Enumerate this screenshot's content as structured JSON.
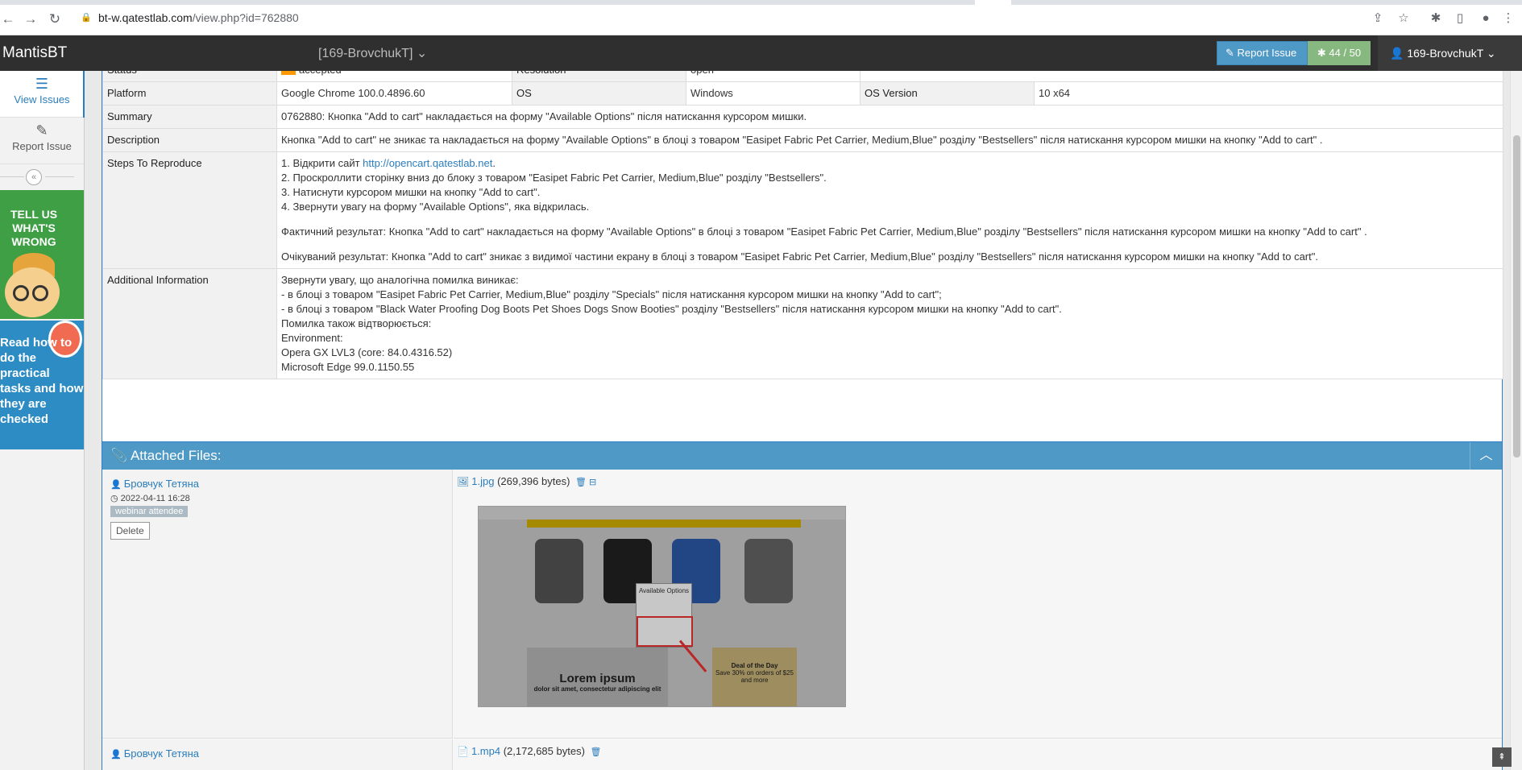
{
  "browser": {
    "url_host": "bt-w.qatestlab.com",
    "url_path": "/view.php?id=762880"
  },
  "navbar": {
    "brand": "MantisBT",
    "project": "[169-BrovchukT]",
    "report_issue": "Report Issue",
    "counter": "44 / 50",
    "user": "169-BrovchukT"
  },
  "sidebar": {
    "view_issues": "View Issues",
    "report_issue": "Report Issue",
    "ad1_text": "TELL US WHAT'S WRONG",
    "ad2_text": "Read how to do the practical tasks and how they are checked"
  },
  "issue": {
    "rows": [
      {
        "label": "Status",
        "value": "accepted",
        "label2": "Resolution",
        "value2": "open"
      },
      {
        "label": "Platform",
        "value": "Google Chrome 100.0.4896.60",
        "label2": "OS",
        "value2": "Windows",
        "label3": "OS Version",
        "value3": "10 x64"
      },
      {
        "label": "Summary",
        "value": "0762880: Кнопка \"Add to cart\" накладається на форму \"Available Options\" після натискання курсором мишки."
      },
      {
        "label": "Description",
        "value": "Кнопка \"Add to cart\" не зникає та накладається на форму \"Available Options\" в блоці з товаром \"Easipet Fabric Pet Carrier, Medium,Blue\" розділу \"Bestsellers\" після натискання курсором мишки на кнопку \"Add to cart\" ."
      },
      {
        "label": "Steps To Reproduce"
      },
      {
        "label": "Additional Information"
      }
    ],
    "steps": {
      "s1_prefix": "1. Відкрити сайт ",
      "s1_link": "http://opencart.qatestlab.net",
      "s1_suffix": ".",
      "s2": "2. Проскроллити сторінку вниз до блоку з товаром \"Easipet Fabric Pet Carrier, Medium,Blue\" розділу \"Bestsellers\".",
      "s3": "3. Натиснути курсором мишки на кнопку \"Add to cart\".",
      "s4": "4. Звернути увагу на форму \"Available Options\", яка відкрилась.",
      "actual": "Фактичний результат: Кнопка \"Add to cart\" накладається на форму \"Available Options\" в блоці з товаром \"Easipet Fabric Pet Carrier, Medium,Blue\" розділу \"Bestsellers\" після натискання курсором мишки на кнопку \"Add to cart\" .",
      "expected": "Очікуваний результат: Кнопка \"Add to cart\" зникає з видимої частини екрану в блоці з товаром \"Easipet Fabric Pet Carrier, Medium,Blue\" розділу \"Bestsellers\" після натискання курсором мишки на кнопку \"Add to cart\"."
    },
    "additional": [
      "Звернути увагу, що аналогічна помилка виникає:",
      "- в блоці з товаром \"Easipet Fabric Pet Carrier, Medium,Blue\" розділу \"Specials\" після натискання курсором мишки на кнопку \"Add to cart\";",
      "- в блоці з товаром \"Black Water Proofing Dog Boots Pet Shoes Dogs Snow Booties\" розділу \"Bestsellers\" після натискання курсором мишки на кнопку \"Add to cart\".",
      "Помилка також відтворюється:",
      "Environment:",
      "Opera GX LVL3 (core: 84.0.4316.52)",
      "Microsoft Edge 99.0.1150.55"
    ]
  },
  "attachments": {
    "title": "Attached Files:",
    "items": [
      {
        "author": "Бровчук Тетяна",
        "date": "2022-04-11 16:28",
        "tag": "webinar attendee",
        "delete": "Delete",
        "file": "1.jpg",
        "size": "(269,396 bytes)"
      },
      {
        "author": "Бровчук Тетяна",
        "file": "1.mp4",
        "size": "(2,172,685 bytes)"
      }
    ],
    "thumb": {
      "popup_title": "Available Options",
      "lorem_line1": "Lorem ipsum",
      "lorem_line2": "dolor sit amet, consectetur adipiscing elit",
      "deal_title": "Deal of the Day",
      "deal_text": "Save 30% on orders of $25 and more"
    }
  },
  "colors": {
    "navbar": "#2f2f2f",
    "accent": "#4f99c6",
    "status_accepted": "#ff9900",
    "counter": "#87b87f"
  }
}
